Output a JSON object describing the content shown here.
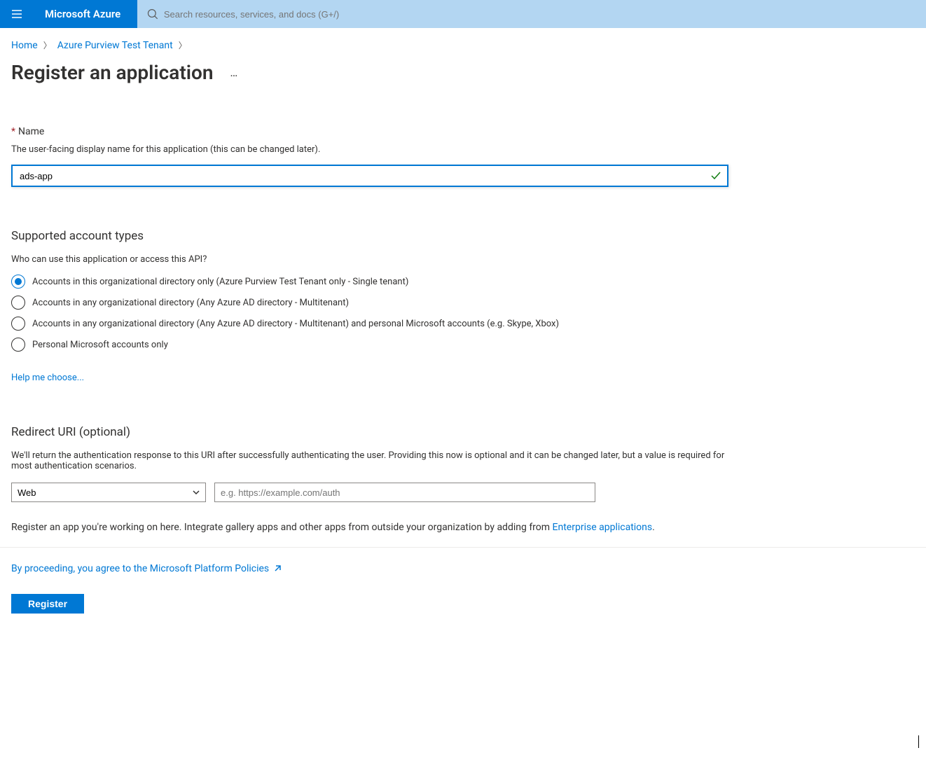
{
  "topbar": {
    "brand": "Microsoft Azure",
    "search_placeholder": "Search resources, services, and docs (G+/)"
  },
  "breadcrumb": {
    "items": [
      {
        "label": "Home"
      },
      {
        "label": "Azure Purview Test Tenant"
      }
    ]
  },
  "page": {
    "title": "Register an application",
    "more_label": "…"
  },
  "name_section": {
    "label": "Name",
    "description": "The user-facing display name for this application (this can be changed later).",
    "value": "ads-app"
  },
  "account_types": {
    "title": "Supported account types",
    "question": "Who can use this application or access this API?",
    "options": [
      {
        "label": "Accounts in this organizational directory only (Azure Purview Test Tenant only - Single tenant)",
        "selected": true
      },
      {
        "label": "Accounts in any organizational directory (Any Azure AD directory - Multitenant)",
        "selected": false
      },
      {
        "label": "Accounts in any organizational directory (Any Azure AD directory - Multitenant) and personal Microsoft accounts (e.g. Skype, Xbox)",
        "selected": false
      },
      {
        "label": "Personal Microsoft accounts only",
        "selected": false
      }
    ],
    "help_link": "Help me choose..."
  },
  "redirect_uri": {
    "title": "Redirect URI (optional)",
    "description": "We'll return the authentication response to this URI after successfully authenticating the user. Providing this now is optional and it can be changed later, but a value is required for most authentication scenarios.",
    "platform_value": "Web",
    "uri_placeholder": "e.g. https://example.com/auth"
  },
  "footer": {
    "register_text": "Register an app you're working on here. Integrate gallery apps and other apps from outside your organization by adding from ",
    "enterprise_link": "Enterprise applications",
    "period": ".",
    "policies_text": "By proceeding, you agree to the Microsoft Platform Policies",
    "register_button": "Register"
  }
}
